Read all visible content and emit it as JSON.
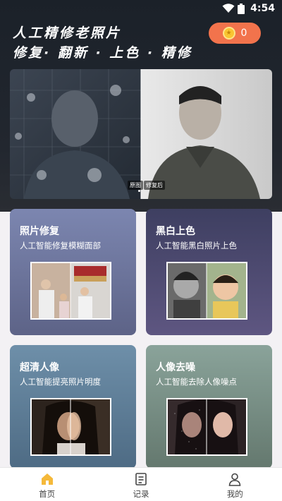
{
  "status_bar": {
    "time": "4:54"
  },
  "header": {
    "title_line1": "人工精修老照片",
    "title_line2": "修复· 翻新 · 上色 · 精修",
    "coins": "0"
  },
  "hero": {
    "label_before": "原图",
    "label_after": "修复后"
  },
  "features": [
    {
      "title": "照片修复",
      "desc": "人工智能修复模糊面部"
    },
    {
      "title": "黑白上色",
      "desc": "人工智能黑白照片上色"
    },
    {
      "title": "超清人像",
      "desc": "人工智能提亮照片明度"
    },
    {
      "title": "人像去噪",
      "desc": "人工智能去除人像噪点"
    }
  ],
  "tabs": [
    {
      "label": "首页",
      "icon": "home-icon",
      "active": true
    },
    {
      "label": "记录",
      "icon": "record-icon",
      "active": false
    },
    {
      "label": "我的",
      "icon": "user-icon",
      "active": false
    }
  ],
  "colors": {
    "coin_badge": "#f2734c",
    "active_tab": "#f5b93a"
  }
}
